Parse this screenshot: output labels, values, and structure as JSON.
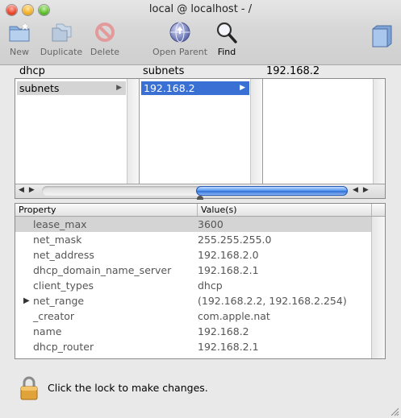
{
  "window": {
    "title": "local @ localhost - /"
  },
  "toolbar": {
    "new_label": "New",
    "duplicate_label": "Duplicate",
    "delete_label": "Delete",
    "open_parent_label": "Open Parent",
    "find_label": "Find"
  },
  "browser": {
    "column_headers": [
      "dhcp",
      "subnets",
      "192.168.2"
    ],
    "col1_item": "subnets",
    "col2_item": "192.168.2"
  },
  "table": {
    "header_property": "Property",
    "header_value": "Value(s)",
    "rows": [
      {
        "property": "lease_max",
        "value": "3600"
      },
      {
        "property": "net_mask",
        "value": "255.255.255.0"
      },
      {
        "property": "net_address",
        "value": "192.168.2.0"
      },
      {
        "property": "dhcp_domain_name_server",
        "value": "192.168.2.1"
      },
      {
        "property": "client_types",
        "value": "dhcp"
      },
      {
        "property": "net_range",
        "value": "(192.168.2.2, 192.168.2.254)"
      },
      {
        "property": "_creator",
        "value": "com.apple.nat"
      },
      {
        "property": "name",
        "value": "192.168.2"
      },
      {
        "property": "dhcp_router",
        "value": "192.168.2.1"
      }
    ]
  },
  "lock": {
    "message": "Click the lock to make changes."
  },
  "icons": {
    "new": "new-folder-icon",
    "duplicate": "duplicate-icon",
    "delete": "delete-icon",
    "open_parent": "globe-icon",
    "find": "magnifier-icon",
    "folder": "folder-icon",
    "lock": "lock-icon"
  }
}
